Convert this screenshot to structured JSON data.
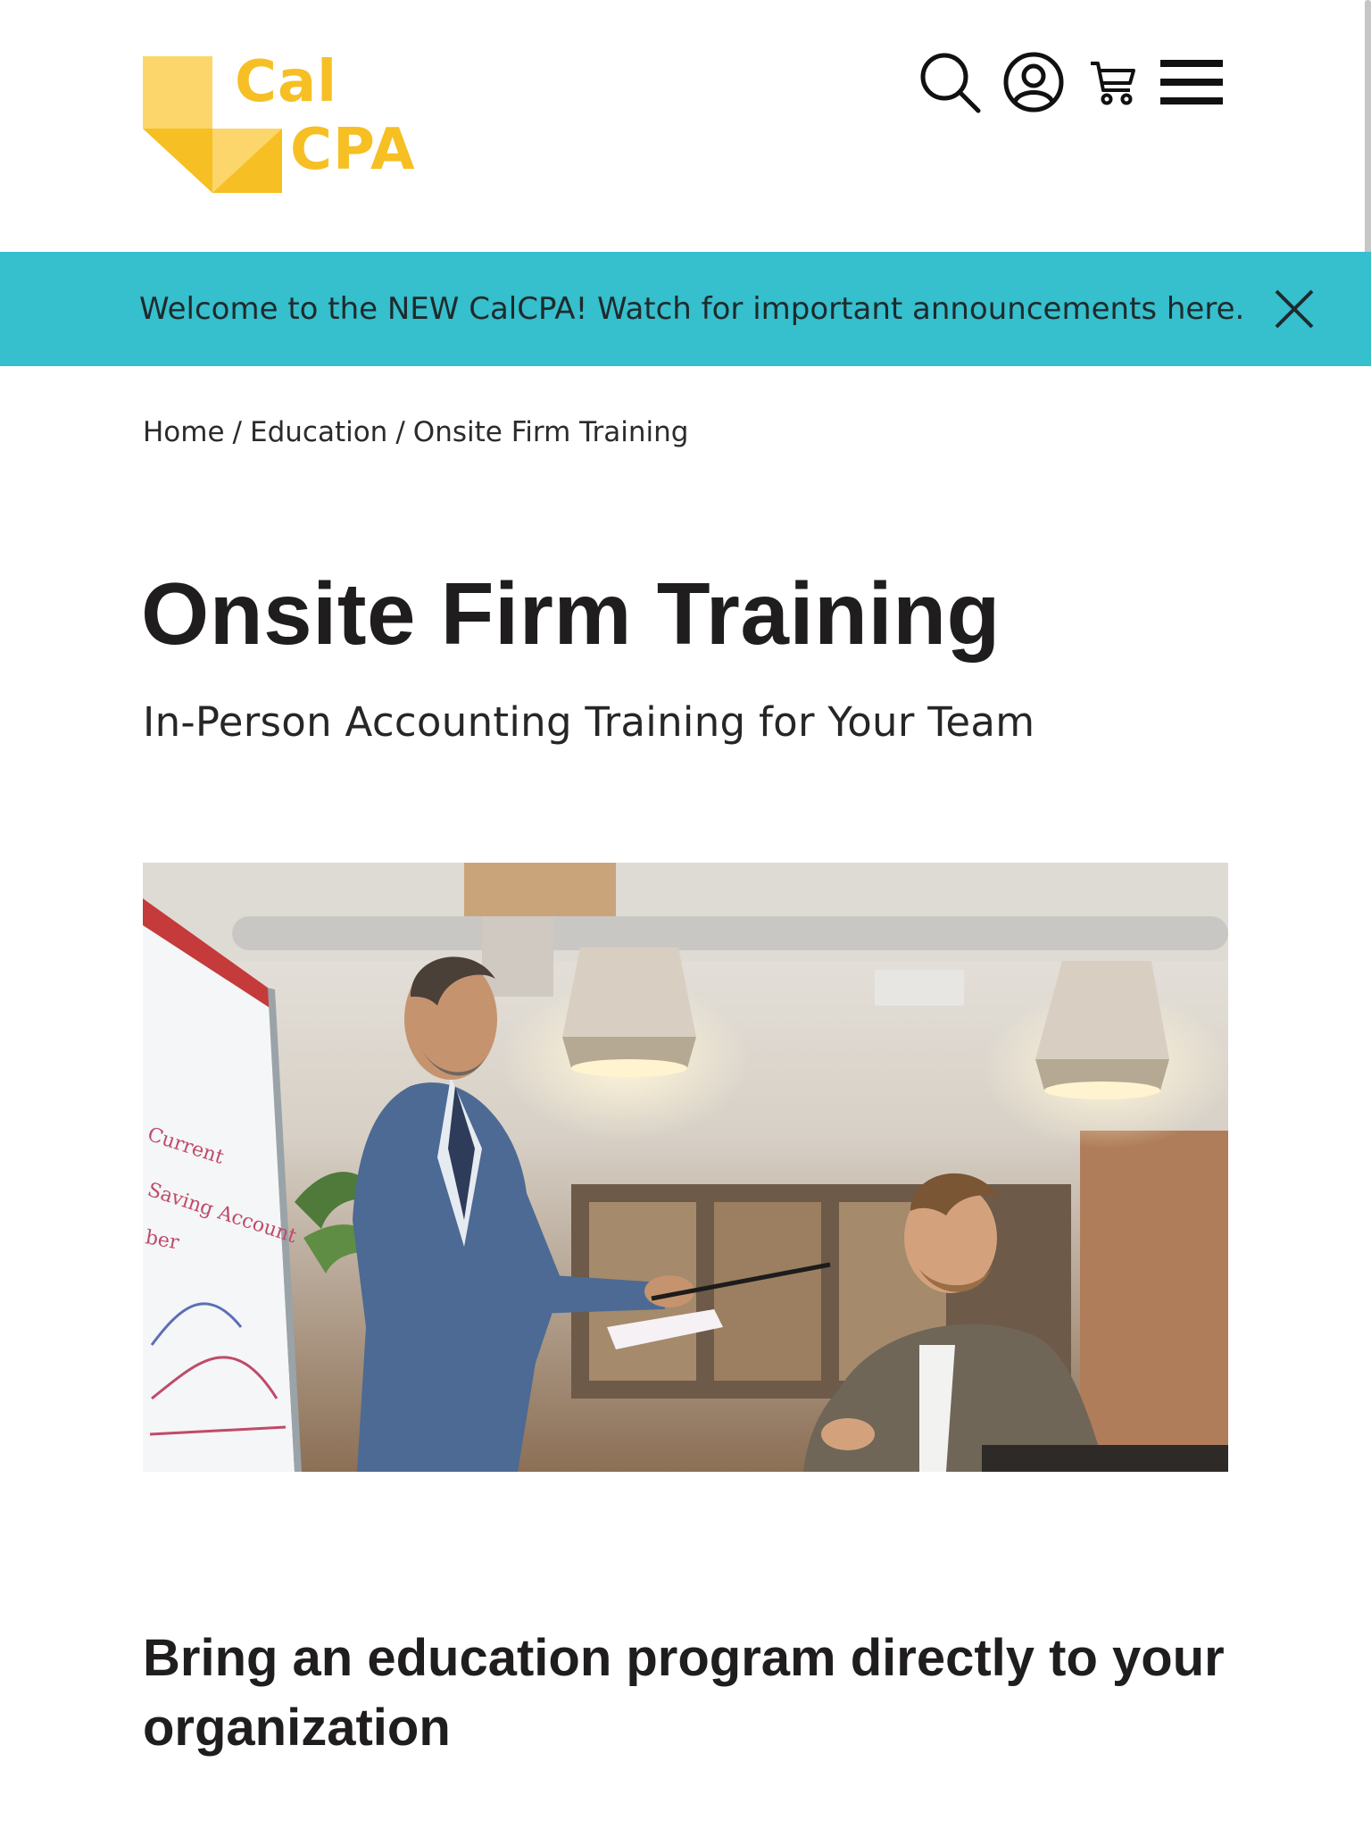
{
  "brand": {
    "logo_line1": "Cal",
    "logo_line2": "CPA",
    "logo_color": "#f6bf23",
    "logo_light_color": "#fcd66a"
  },
  "header": {
    "icons": [
      "search-icon",
      "account-icon",
      "cart-icon",
      "menu-icon"
    ]
  },
  "announcement": {
    "text": "Welcome to the NEW CalCPA! Watch for important announcements here.",
    "background": "#36bfcd"
  },
  "breadcrumb": {
    "items": [
      "Home",
      "Education",
      "Onsite Firm Training"
    ],
    "separator": "/"
  },
  "page": {
    "title": "Onsite Firm Training",
    "subtitle": "In-Person Accounting Training for Your Team",
    "section_heading": "Bring an education program directly to your organization"
  },
  "hero_image": {
    "whiteboard_words": [
      "Current",
      "Saving Account",
      "ber"
    ]
  }
}
